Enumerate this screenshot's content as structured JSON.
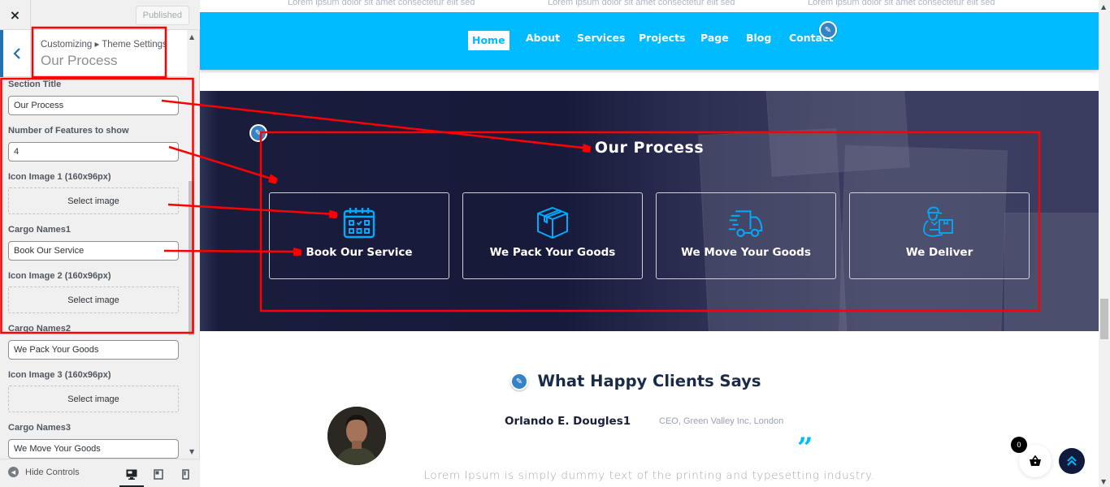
{
  "sidebar": {
    "close_icon": "×",
    "published_label": "Published",
    "breadcrumb": "Customizing ▸ Theme Settings",
    "section_title": "Our Process",
    "fields": {
      "section_title": {
        "label": "Section Title",
        "value": "Our Process"
      },
      "num_features": {
        "label": "Number of Features to show",
        "value": "4"
      },
      "icon_image_1": {
        "label": "Icon Image 1 (160x96px)",
        "button": "Select image"
      },
      "cargo_name_1": {
        "label": "Cargo Names1",
        "value": "Book Our Service"
      },
      "icon_image_2": {
        "label": "Icon Image 2 (160x96px)",
        "button": "Select image"
      },
      "cargo_name_2": {
        "label": "Cargo Names2",
        "value": "We Pack Your Goods"
      },
      "icon_image_3": {
        "label": "Icon Image 3 (160x96px)",
        "button": "Select image"
      },
      "cargo_name_3": {
        "label": "Cargo Names3",
        "value": "We Move Your Goods"
      }
    },
    "footer": {
      "hide_controls": "Hide Controls",
      "devices": [
        "desktop",
        "tablet",
        "mobile"
      ],
      "active_device": "desktop"
    }
  },
  "preview": {
    "topbar_texts": [
      "Lorem ipsum dolor sit amet consectetur elit sed",
      "Lorem ipsum dolor sit amet consectetur elit sed",
      "Lorem ipsum dolor sit amet consectetur elit sed"
    ],
    "nav": {
      "items": [
        "Home",
        "About",
        "Services",
        "Projects",
        "Page",
        "Blog",
        "Contact"
      ],
      "active": "Home"
    },
    "process": {
      "title": "Our Process",
      "cards": [
        {
          "icon": "calendar-icon",
          "label": "Book Our Service"
        },
        {
          "icon": "box-icon",
          "label": "We Pack Your Goods"
        },
        {
          "icon": "truck-icon",
          "label": "We Move Your Goods"
        },
        {
          "icon": "delivery-man-icon",
          "label": "We Deliver"
        }
      ]
    },
    "testimonials": {
      "title": "What Happy Clients Says",
      "client_name": "Orlando E. Dougles1",
      "client_role": "CEO, Green Valley Inc, London",
      "quote_mark": "”",
      "text": "Lorem Ipsum is simply dummy text of the printing and typesetting industry."
    },
    "cart_count": "0"
  },
  "colors": {
    "nav_bg": "#00bbff",
    "accent": "#00bbff",
    "wp_blue": "#2271b1",
    "annotation_red": "#ff0000",
    "process_bg": "#171a3a"
  }
}
